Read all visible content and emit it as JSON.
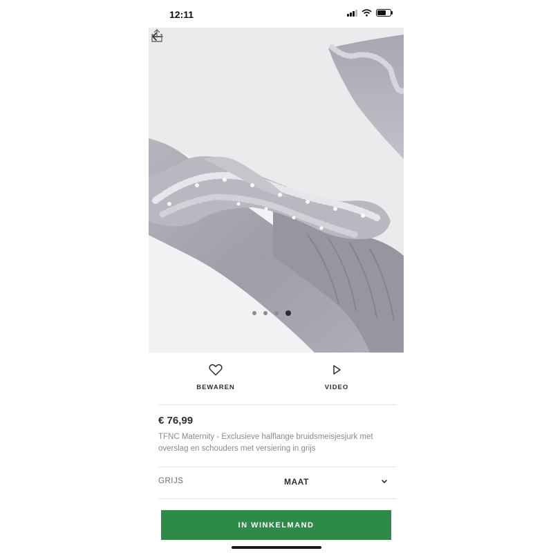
{
  "status_bar": {
    "time": "12:11"
  },
  "product": {
    "gallery": {
      "total_images": 4,
      "active_index": 3,
      "image_alt": "grey satin dress with embellished beaded neckline"
    },
    "actions": {
      "save_label": "BEWAREN",
      "video_label": "VIDEO"
    },
    "price": "€ 76,99",
    "description": "TFNC Maternity - Exclusieve halflange bruidsmeisjesjurk met overslag en schouders met versiering in grijs",
    "colour": "GRIJS",
    "size_label": "MAAT",
    "add_to_bag_label": "IN WINKELMAND"
  },
  "colors": {
    "accent": "#2e8a47",
    "fabric": "#a5a3ad",
    "background": "#ebebed"
  },
  "icons": [
    "back-arrow-icon",
    "share-icon",
    "heart-icon",
    "play-icon",
    "chevron-down-icon",
    "signal-icon",
    "wifi-icon",
    "battery-icon"
  ]
}
